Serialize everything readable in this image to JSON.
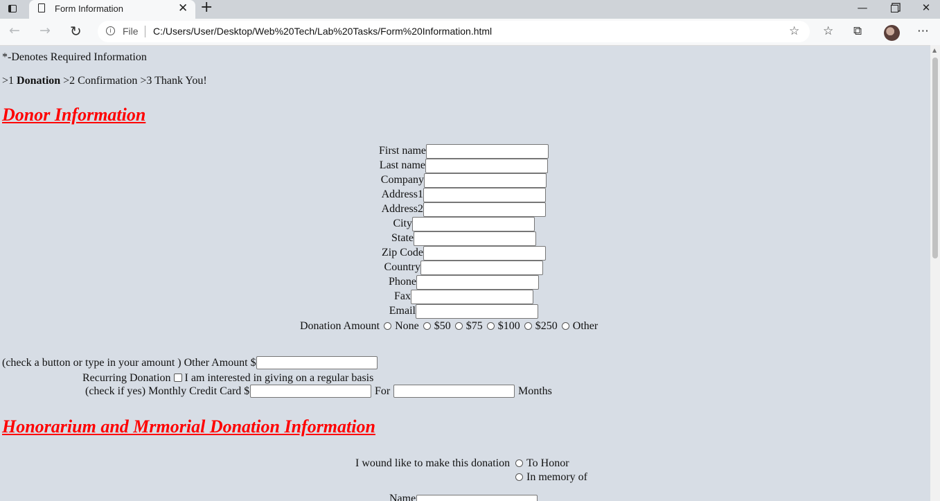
{
  "browser": {
    "tab_title": "Form Information",
    "tab_close": "✕",
    "new_tab": "+",
    "address_file": "File",
    "url": "C:/Users/User/Desktop/Web%20Tech/Lab%20Tasks/Form%20Information.html",
    "window_min": "—",
    "window_close": "✕"
  },
  "page": {
    "required_note": "*-Denotes Required Information",
    "steps": {
      "prefix1": ">1 ",
      "step1": "Donation",
      "rest": " >2 Confirmation >3 Thank You!"
    },
    "donor_heading": "Donor Information",
    "fields": [
      {
        "label": "First name"
      },
      {
        "label": "Last name"
      },
      {
        "label": "Company"
      },
      {
        "label": "Address1"
      },
      {
        "label": "Address2"
      },
      {
        "label": "City"
      },
      {
        "label": "State"
      },
      {
        "label": "Zip Code"
      },
      {
        "label": "Country"
      },
      {
        "label": "Phone"
      },
      {
        "label": "Fax"
      },
      {
        "label": "Email"
      }
    ],
    "donation_amount": {
      "label": "Donation Amount",
      "options": [
        "None",
        "$50",
        "$75",
        "$100",
        "$250",
        "Other"
      ]
    },
    "other_amount_label": "(check a button or type in your amount ) Other Amount $",
    "recurring": {
      "label": "Recurring Donation",
      "checkbox_label": "I am interested in giving on a regular basis",
      "monthly_label": "(check if yes) Monthly Credit Card $",
      "for_label": "For",
      "months_label": "Months"
    },
    "honorarium_heading": "Honorarium and Mrmorial Donation Information",
    "donation_type": {
      "label": "I wound like to make this donation",
      "options": [
        "To Honor",
        "In memory of"
      ]
    },
    "name_label": "Name"
  },
  "colors": {
    "heading": "#ff0000",
    "page_bg": "#d7dde5"
  }
}
